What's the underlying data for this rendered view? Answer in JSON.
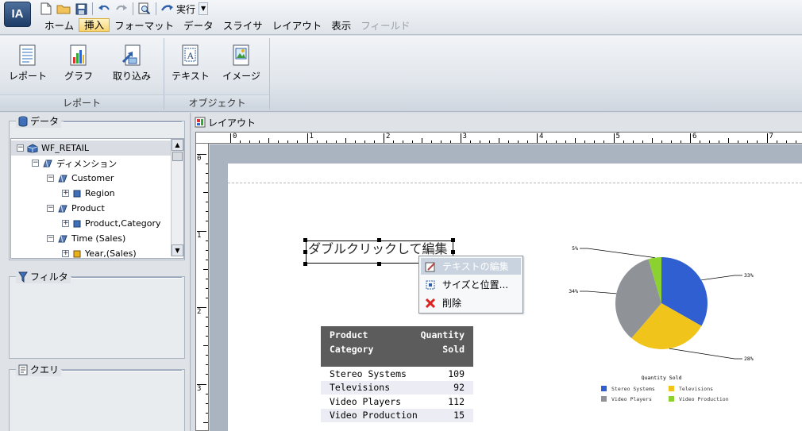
{
  "app": {
    "logo": "IA"
  },
  "qat": {
    "run_label": "実行"
  },
  "menu": [
    {
      "label": "ホーム",
      "state": "normal"
    },
    {
      "label": "挿入",
      "state": "active"
    },
    {
      "label": "フォーマット",
      "state": "normal"
    },
    {
      "label": "データ",
      "state": "normal"
    },
    {
      "label": "スライサ",
      "state": "normal"
    },
    {
      "label": "レイアウト",
      "state": "normal"
    },
    {
      "label": "表示",
      "state": "normal"
    },
    {
      "label": "フィールド",
      "state": "disabled"
    }
  ],
  "ribbon": {
    "groups": [
      {
        "title": "レポート",
        "buttons": [
          "レポート",
          "グラフ",
          "取り込み"
        ]
      },
      {
        "title": "オブジェクト",
        "buttons": [
          "テキスト",
          "イメージ"
        ]
      }
    ]
  },
  "left": {
    "data_title": "データ",
    "filter_title": "フィルタ",
    "query_title": "クエリ",
    "tree": [
      {
        "label": "WF_RETAIL",
        "exp": "⊟"
      },
      {
        "label": "ディメンション",
        "exp": "⊟"
      },
      {
        "label": "Customer",
        "exp": "⊟"
      },
      {
        "label": "Region",
        "exp": "⊞"
      },
      {
        "label": "Product",
        "exp": "⊟"
      },
      {
        "label": "Product,Category",
        "exp": "⊞"
      },
      {
        "label": "Time (Sales)",
        "exp": "⊟"
      },
      {
        "label": "Year,(Sales)",
        "exp": "⊞"
      }
    ]
  },
  "layout": {
    "title": "レイアウト",
    "ruler_h": [
      "0",
      "1",
      "2",
      "3",
      "4",
      "5",
      "6",
      "7"
    ],
    "ruler_v": [
      "0",
      "1",
      "2",
      "3"
    ]
  },
  "textbox": {
    "text": "ダブルクリックして編集"
  },
  "context_menu": [
    {
      "label": "テキストの編集",
      "icon": "edit-text-icon",
      "highlighted": true
    },
    {
      "label": "サイズと位置...",
      "icon": "resize-icon",
      "highlighted": false
    },
    {
      "label": "削除",
      "icon": "delete-x-icon",
      "highlighted": false
    }
  ],
  "table": {
    "header": {
      "col1_line1": "Product",
      "col1_line2": "Category",
      "col2_line1": "Quantity",
      "col2_line2": "Sold"
    },
    "rows": [
      {
        "category": "Stereo Systems",
        "qty": "109"
      },
      {
        "category": "Televisions",
        "qty": "92"
      },
      {
        "category": "Video Players",
        "qty": "112"
      },
      {
        "category": "Video Production",
        "qty": "15"
      }
    ]
  },
  "chart_data": {
    "type": "pie",
    "title": "Quantity Sold",
    "categories": [
      "Stereo Systems",
      "Televisions",
      "Video Players",
      "Video Production"
    ],
    "values": [
      109,
      92,
      112,
      15
    ],
    "percent_labels": [
      "33%",
      "28%",
      "34%",
      "5%"
    ],
    "colors": [
      "#2f5fd0",
      "#f1c41c",
      "#8f9397",
      "#8bd130"
    ],
    "legend_position": "bottom"
  }
}
